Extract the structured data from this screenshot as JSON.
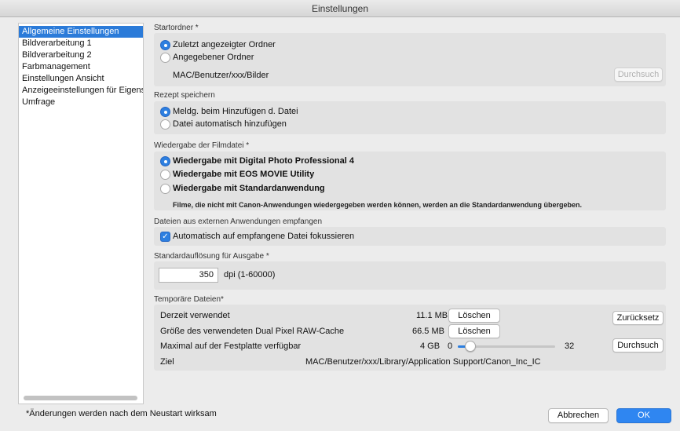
{
  "window": {
    "title": "Einstellungen"
  },
  "sidebar": {
    "items": [
      {
        "label": "Allgemeine Einstellungen",
        "selected": true
      },
      {
        "label": "Bildverarbeitung 1"
      },
      {
        "label": "Bildverarbeitung 2"
      },
      {
        "label": "Farbmanagement"
      },
      {
        "label": "Einstellungen Ansicht"
      },
      {
        "label": "Anzeigeeinstellungen für Eigense"
      },
      {
        "label": "Umfrage"
      }
    ]
  },
  "startordner": {
    "label": "Startordner *",
    "options": [
      "Zuletzt angezeigter Ordner",
      "Angegebener Ordner"
    ],
    "selected_index": 0,
    "path": "MAC/Benutzer/xxx/Bilder",
    "browse_label": "Durchsuch"
  },
  "rezept": {
    "label": "Rezept speichern",
    "options": [
      "Meldg. beim Hinzufügen d. Datei",
      "Datei automatisch hinzufügen"
    ],
    "selected_index": 0
  },
  "filmdatei": {
    "label": "Wiedergabe der Filmdatei *",
    "options": [
      "Wiedergabe mit Digital Photo Professional 4",
      "Wiedergabe mit EOS MOVIE Utility",
      "Wiedergabe mit Standardanwendung"
    ],
    "selected_index": 0,
    "note": "Filme, die nicht mit Canon-Anwendungen wiedergegeben werden können, werden an die Standardanwendung übergeben."
  },
  "extern": {
    "label": "Dateien aus externen Anwendungen empfangen",
    "checkbox_label": "Automatisch auf empfangene Datei fokussieren",
    "checked": true
  },
  "aufloesung": {
    "label": "Standardauflösung für Ausgabe *",
    "value": "350",
    "unit": "dpi (1-60000)"
  },
  "temp": {
    "label": "Temporäre Dateien*",
    "current_label": "Derzeit verwendet",
    "current_value": "11.1 MB",
    "cache_label": "Größe des verwendeten Dual Pixel RAW-Cache",
    "cache_value": "66.5 MB",
    "delete_label": "Löschen",
    "reset_label": "Zurücksetz",
    "max_label": "Maximal auf der Festplatte verfügbar",
    "max_value": "4 GB",
    "slider_min": "0",
    "slider_max": "32",
    "slider_value": 4,
    "browse_label": "Durchsuch",
    "target_label": "Ziel",
    "target_path": "MAC/Benutzer/xxx/Library/Application Support/Canon_Inc_IC"
  },
  "footer": {
    "note": "*Änderungen werden nach dem Neustart wirksam",
    "cancel_label": "Abbrechen",
    "ok_label": "OK"
  },
  "colors": {
    "accent": "#2d7fe0",
    "selection": "#2b7bd9"
  }
}
